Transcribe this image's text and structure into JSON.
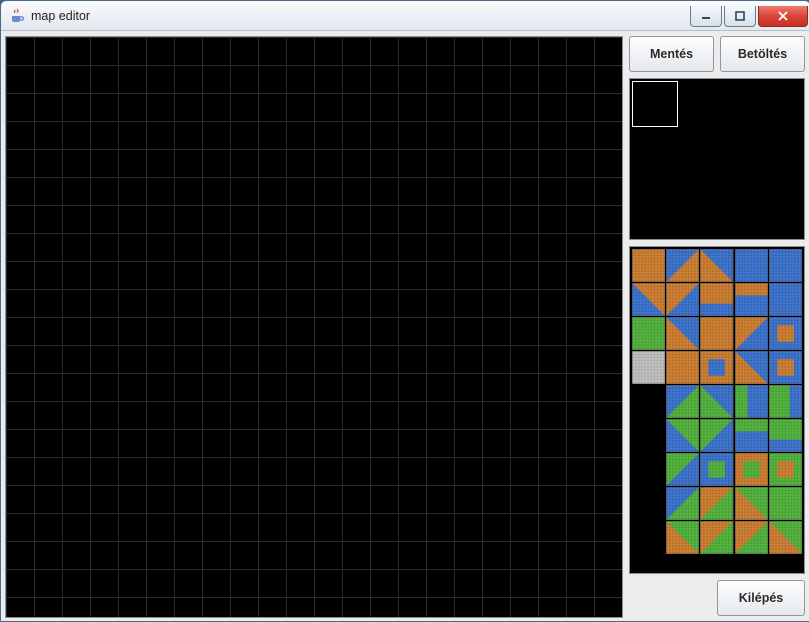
{
  "window": {
    "title": "map editor"
  },
  "buttons": {
    "save": "Mentés",
    "load": "Betöltés",
    "exit": "Kilépés"
  },
  "colors": {
    "dirt": "#c87a2e",
    "water": "#3a6fc8",
    "grass": "#4fae3a",
    "stone": "#bcbcbc",
    "grid": "#2a2a2a"
  },
  "palette": [
    {
      "bg": "dirt",
      "shape": "full"
    },
    {
      "bg": "dirt",
      "shape": "tri-tl",
      "fg": "water"
    },
    {
      "bg": "dirt",
      "shape": "tri-tr",
      "fg": "water"
    },
    {
      "bg": "water",
      "shape": "full"
    },
    {
      "bg": "water",
      "shape": "full"
    },
    {
      "bg": "dirt",
      "shape": "tri-bl",
      "fg": "water"
    },
    {
      "bg": "dirt",
      "shape": "tri-br",
      "fg": "water"
    },
    {
      "bg": "dirt",
      "shape": "bar-b",
      "fg": "water"
    },
    {
      "bg": "water",
      "shape": "bar-t",
      "fg": "dirt"
    },
    {
      "bg": "water",
      "shape": "full"
    },
    {
      "bg": "grass",
      "shape": "full"
    },
    {
      "bg": "dirt",
      "shape": "tri-tr",
      "fg": "water"
    },
    {
      "bg": "dirt",
      "shape": "full"
    },
    {
      "bg": "water",
      "shape": "tri-tl",
      "fg": "dirt"
    },
    {
      "bg": "water",
      "shape": "hole",
      "fg": "dirt"
    },
    {
      "bg": "stone",
      "shape": "full"
    },
    {
      "bg": "dirt",
      "shape": "full"
    },
    {
      "bg": "dirt",
      "shape": "hole",
      "fg": "water"
    },
    {
      "bg": "water",
      "shape": "tri-bl",
      "fg": "dirt"
    },
    {
      "bg": "water",
      "shape": "hole",
      "fg": "dirt"
    },
    {
      "bg": "empty"
    },
    {
      "bg": "grass",
      "shape": "tri-tl",
      "fg": "water"
    },
    {
      "bg": "grass",
      "shape": "tri-tr",
      "fg": "water"
    },
    {
      "bg": "water",
      "shape": "bar-l",
      "fg": "grass"
    },
    {
      "bg": "grass",
      "shape": "bar-r",
      "fg": "water"
    },
    {
      "bg": "empty"
    },
    {
      "bg": "grass",
      "shape": "tri-bl",
      "fg": "water"
    },
    {
      "bg": "grass",
      "shape": "tri-br",
      "fg": "water"
    },
    {
      "bg": "water",
      "shape": "bar-t",
      "fg": "grass"
    },
    {
      "bg": "grass",
      "shape": "bar-b",
      "fg": "water"
    },
    {
      "bg": "empty"
    },
    {
      "bg": "water",
      "shape": "tri-tl",
      "fg": "grass"
    },
    {
      "bg": "water",
      "shape": "hole",
      "fg": "grass"
    },
    {
      "bg": "dirt",
      "shape": "hole",
      "fg": "grass"
    },
    {
      "bg": "grass",
      "shape": "hole",
      "fg": "dirt"
    },
    {
      "bg": "empty"
    },
    {
      "bg": "water",
      "shape": "tri-br",
      "fg": "grass"
    },
    {
      "bg": "grass",
      "shape": "tri-tl",
      "fg": "dirt"
    },
    {
      "bg": "dirt",
      "shape": "tri-tr",
      "fg": "grass"
    },
    {
      "bg": "grass",
      "shape": "full"
    },
    {
      "bg": "empty"
    },
    {
      "bg": "grass",
      "shape": "tri-bl",
      "fg": "dirt"
    },
    {
      "bg": "dirt",
      "shape": "tri-br",
      "fg": "grass"
    },
    {
      "bg": "grass",
      "shape": "tri-tl",
      "fg": "dirt"
    },
    {
      "bg": "dirt",
      "shape": "tri-tr",
      "fg": "grass"
    }
  ]
}
